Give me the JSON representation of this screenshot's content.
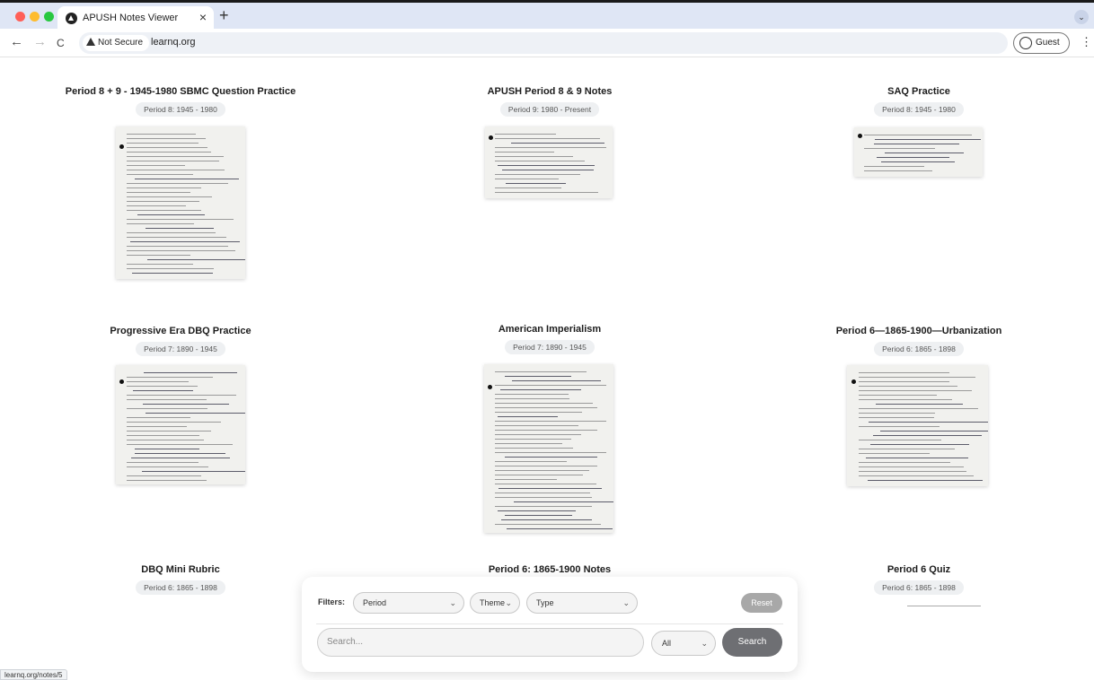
{
  "browser": {
    "tab_title": "APUSH Notes Viewer",
    "tab_close": "×",
    "new_tab": "+",
    "tab_menu": "⌄",
    "security_label": "Not Secure",
    "url": "learnq.org",
    "guest_label": "Guest",
    "menu": "⋮",
    "back": "←",
    "forward": "→",
    "reload": "C",
    "traffic_colors": [
      "#ff5f57",
      "#febc2e",
      "#28c840"
    ]
  },
  "notes": [
    {
      "title": "Period 8 + 9 - 1945-1980 SBMC Question Practice",
      "period": "Period 8: 1945 - 1980"
    },
    {
      "title": "APUSH Period 8 & 9 Notes",
      "period": "Period 9: 1980 - Present"
    },
    {
      "title": "SAQ Practice",
      "period": "Period 8: 1945 - 1980"
    },
    {
      "title": "Progressive Era DBQ Practice",
      "period": "Period 7: 1890 - 1945"
    },
    {
      "title": "American Imperialism",
      "period": "Period 7: 1890 - 1945"
    },
    {
      "title": "Period 6—1865-1900—Urbanization",
      "period": "Period 6: 1865 - 1898"
    },
    {
      "title": "DBQ Mini Rubric",
      "period": "Period 6: 1865 - 1898"
    },
    {
      "title": "Period 6: 1865-1900 Notes",
      "period": ""
    },
    {
      "title": "Period 6 Quiz",
      "period": "Period 6: 1865 - 1898"
    }
  ],
  "filters": {
    "label": "Filters:",
    "period": "Period",
    "theme": "Theme",
    "type": "Type",
    "reset": "Reset",
    "search_placeholder": "Search...",
    "scope": "All",
    "search_button": "Search",
    "chevron": "⌄"
  },
  "status_bar": "learnq.org/notes/5"
}
